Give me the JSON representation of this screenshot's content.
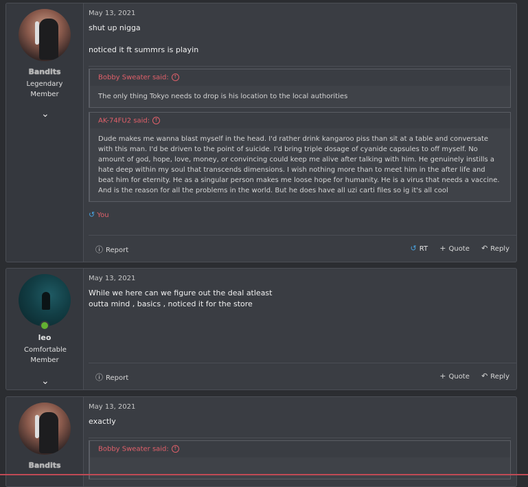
{
  "posts": [
    {
      "user": {
        "name": "Bandits",
        "title": "Legendary Member"
      },
      "date": "May 13, 2021",
      "body": [
        "shut up nigga",
        "noticed it ft summrs is playin"
      ],
      "quotes": [
        {
          "head": "Bobby Sweater said:",
          "body": "The only thing Tokyo needs to drop is his location to the local authorities"
        },
        {
          "head": "AK-74FU2 said:",
          "body": "Dude makes me wanna blast myself in the head. I'd rather drink kangaroo piss than sit at a table and conversate with this man. I'd be driven to the point of suicide. I'd bring triple dosage of cyanide capsules to off myself. No amount of god, hope, love, money, or convincing could keep me alive after talking with him. He genuinely instills a hate deep within my soul that transcends dimensions. I wish nothing more than to meet him in the after life and beat him for eternity. He as a singular person makes me loose hope for humanity. He is a virus that needs a vaccine. And is the reason for all the problems in the world. But he does have all uzi carti files so ig it's all cool"
        }
      ],
      "reaction": "You",
      "footer": {
        "report": "Report",
        "rt": "RT",
        "quote": "Quote",
        "reply": "Reply"
      }
    },
    {
      "user": {
        "name": "leo",
        "title": "Comfortable Member"
      },
      "date": "May 13, 2021",
      "body": [
        "While we here can we figure out the deal atleast",
        "outta mind , basics , noticed it for the store"
      ],
      "footer": {
        "report": "Report",
        "quote": "Quote",
        "reply": "Reply"
      }
    },
    {
      "user": {
        "name": "Bandits"
      },
      "date": "May 13, 2021",
      "body": [
        "exactly"
      ],
      "quotes": [
        {
          "head": "Bobby Sweater said:"
        }
      ]
    }
  ],
  "icons": {
    "chevron": "chevron-down-icon",
    "quote_arrow": "arrow-up-circle-icon",
    "report": "report-icon",
    "retweet": "retweet-icon",
    "plus": "plus-icon",
    "reply": "reply-icon",
    "online": "online-status-icon"
  },
  "colors": {
    "quote_author": "#e0606a",
    "retweet": "#4aa3df",
    "online": "#63b132"
  }
}
